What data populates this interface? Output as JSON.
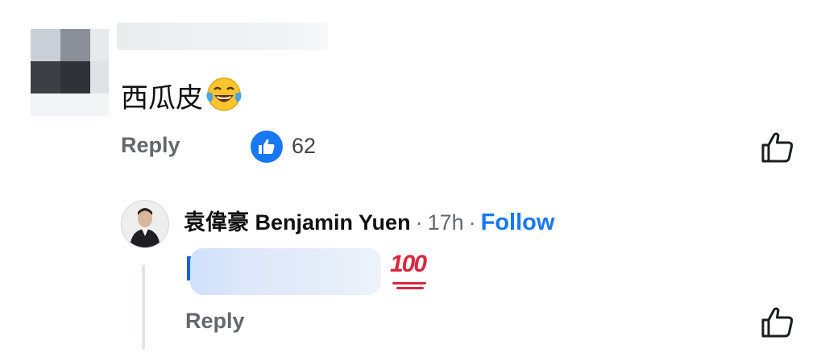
{
  "comment": {
    "text": "西瓜皮",
    "emoji_icon": "tears-of-joy-emoji",
    "reply_label": "Reply",
    "like_count": "62"
  },
  "reply": {
    "author_name": "袁偉豪 Benjamin Yuen",
    "separator": "·",
    "time": "17h",
    "follow_label": "Follow",
    "emoji_icon": "hundred-points-emoji",
    "emoji_text": "100",
    "reply_label": "Reply"
  },
  "colors": {
    "accent": "#1877f2",
    "muted_text": "#65676b",
    "hundred_red": "#d8283f"
  }
}
